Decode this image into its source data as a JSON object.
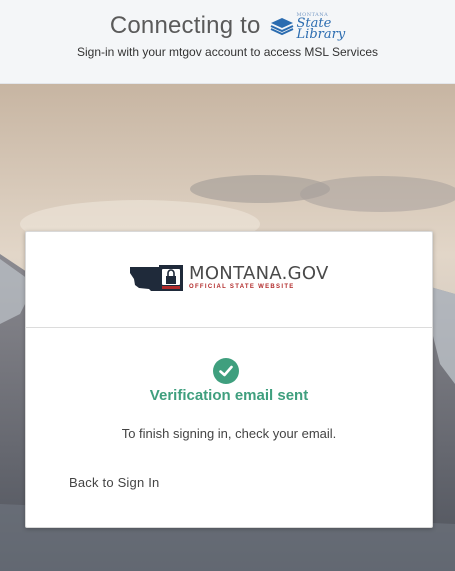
{
  "header": {
    "connecting_label": "Connecting to",
    "logo": {
      "icon": "book-stack-icon",
      "top_word": "Montana",
      "state_word": "State",
      "library_word": "Library"
    },
    "subtitle": "Sign-in with your mtgov account to access MSL Services"
  },
  "card": {
    "brand": {
      "icon": "montana-state-padlock-icon",
      "title": "MONTANA.GOV",
      "subtitle": "OFFICIAL STATE WEBSITE"
    },
    "status": {
      "icon": "check-circle-icon",
      "title": "Verification email sent",
      "message": "To finish signing in, check your email."
    },
    "back_link": "Back to Sign In"
  },
  "colors": {
    "accent_green": "#3f9f7e",
    "library_blue": "#2b6cb0",
    "brand_red": "#b22a2a"
  }
}
